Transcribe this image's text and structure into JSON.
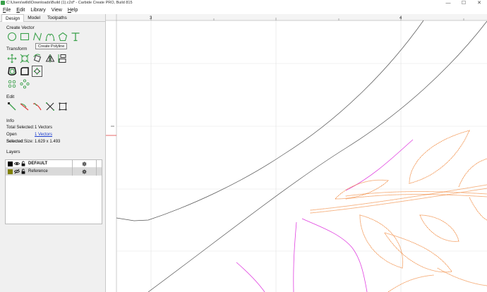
{
  "titlebar": {
    "title": "C:\\Users\\willd\\Downloads\\Build (1).c2d* - Carbide Create PRO, Build 815",
    "minimize": "—",
    "maximize": "☐",
    "close": "✕"
  },
  "menu": {
    "items": [
      {
        "first": "F",
        "rest": "ile"
      },
      {
        "first": "E",
        "rest": "dit"
      },
      {
        "first": "",
        "rest": "Library"
      },
      {
        "first": "",
        "rest": "View"
      },
      {
        "first": "H",
        "rest": "elp"
      }
    ]
  },
  "tabs": [
    "Design",
    "Model",
    "Toolpaths"
  ],
  "panel": {
    "create_vector": "Create Vector",
    "tooltip": "Create Polyline",
    "transform": "Transform",
    "edit": "Edit",
    "info": "Info",
    "layers": "Layers"
  },
  "info": {
    "total_selected_label": "Total Selected:",
    "total_selected_value": "1 Vectors",
    "open_selected_label": "Open Selected:",
    "open_selected_value": "1 Vectors",
    "selected_size_label": "Selected Size:",
    "selected_size_value": "1.629 x 1.493"
  },
  "layers": [
    {
      "name": "DEFAULT",
      "color": "#000000",
      "bold": true
    },
    {
      "name": "Reference",
      "color": "#808000",
      "bold": false
    }
  ],
  "ruler": {
    "labels": [
      "3",
      "4"
    ]
  },
  "colors": {
    "tool_green": "#3aa04a",
    "vector_orange": "#f08030",
    "vector_magenta": "#e040e0",
    "vector_gray": "#555555"
  }
}
